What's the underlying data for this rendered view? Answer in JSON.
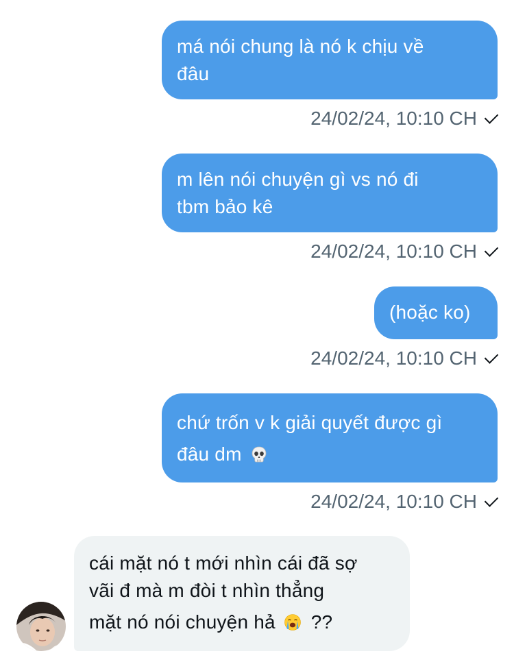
{
  "messages": [
    {
      "lines": [
        "má nói chung là nó k chịu về",
        "đâu"
      ],
      "timestamp": "24/02/24, 10:10 CH"
    },
    {
      "lines": [
        "m lên nói chuyện gì vs nó đi",
        "tbm bảo kê"
      ],
      "timestamp": "24/02/24, 10:10 CH"
    },
    {
      "lines": [
        "(hoặc ko)"
      ],
      "timestamp": "24/02/24, 10:10 CH"
    },
    {
      "lines": [
        "chứ trốn v k giải quyết được gì",
        "đâu dm"
      ],
      "emoji": "skull-emoji",
      "timestamp": "24/02/24, 10:10 CH"
    }
  ],
  "incoming": {
    "lines": [
      "cái mặt nó t mới nhìn cái đã sợ",
      "vãi đ mà m đòi t nhìn thẳng",
      "mặt nó nói chuyện hả"
    ],
    "suffix": "??",
    "emoji": "loudly-crying-face-emoji"
  },
  "colors": {
    "outgoing_bubble": "#4c9ce9",
    "incoming_bubble": "#eff3f4",
    "timestamp_text": "#536471"
  }
}
